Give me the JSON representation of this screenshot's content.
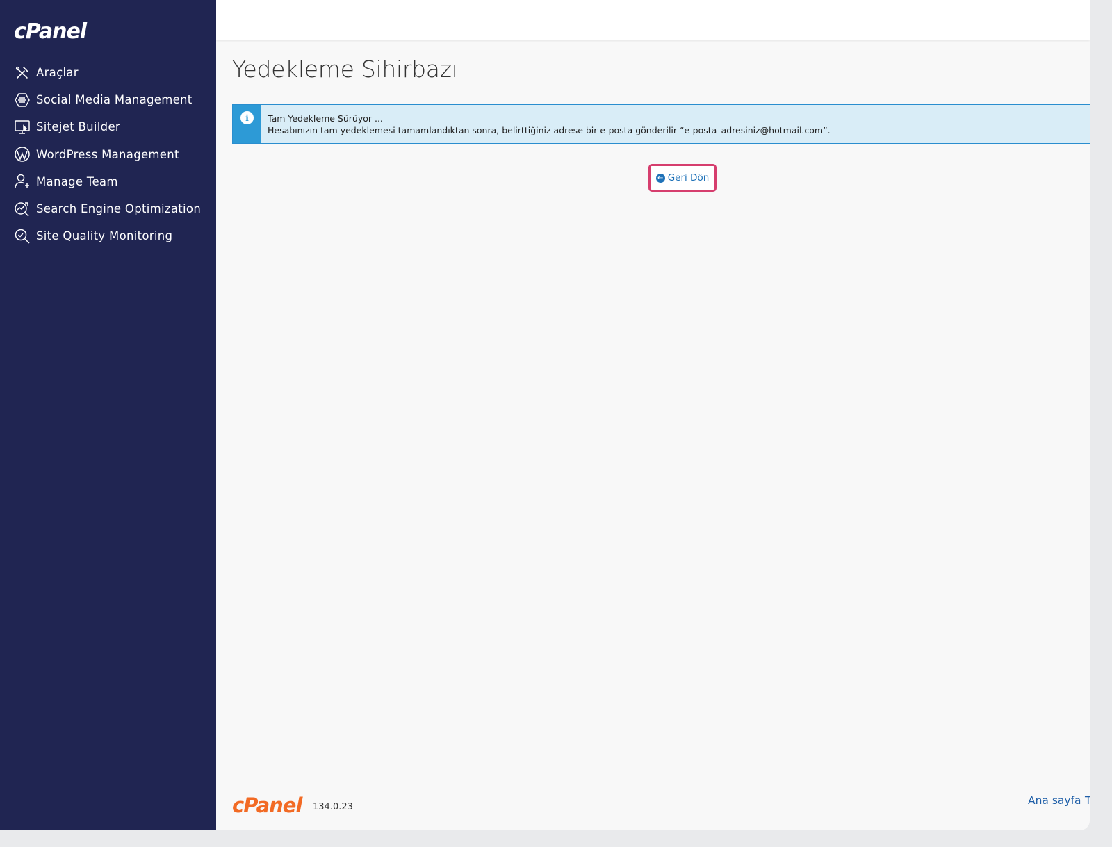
{
  "sidebar": {
    "logo": "cPanel",
    "items": [
      {
        "label": "Araçlar",
        "icon": "tools-icon"
      },
      {
        "label": "Social Media Management",
        "icon": "social-media-icon"
      },
      {
        "label": "Sitejet Builder",
        "icon": "monitor-icon"
      },
      {
        "label": "WordPress Management",
        "icon": "wordpress-icon"
      },
      {
        "label": "Manage Team",
        "icon": "user-add-icon"
      },
      {
        "label": "Search Engine Optimization",
        "icon": "seo-chart-icon"
      },
      {
        "label": "Site Quality Monitoring",
        "icon": "magnify-check-icon"
      }
    ]
  },
  "main": {
    "title": "Yedekleme Sihirbazı",
    "alert": {
      "icon": "info-icon",
      "heading": "Tam Yedekleme Sürüyor ...",
      "message": "Hesabınızın tam yedeklemesi tamamlandıktan sonra, belirttiğiniz adrese bir e-posta gönderilir “e-posta_adresiniz@hotmail.com”."
    },
    "back_button": {
      "label": "Geri Dön",
      "icon": "arrow-left-circle-icon"
    }
  },
  "footer": {
    "logo": "cPanel",
    "version": "134.0.23",
    "links": [
      "Ana sayfa",
      "T"
    ]
  },
  "colors": {
    "sidebar_bg": "#202552",
    "alert_bg": "#d9edf7",
    "alert_accent": "#2d9ad6",
    "highlight": "#d63e6e",
    "link": "#1f72b8",
    "brand_orange": "#f26a24"
  }
}
